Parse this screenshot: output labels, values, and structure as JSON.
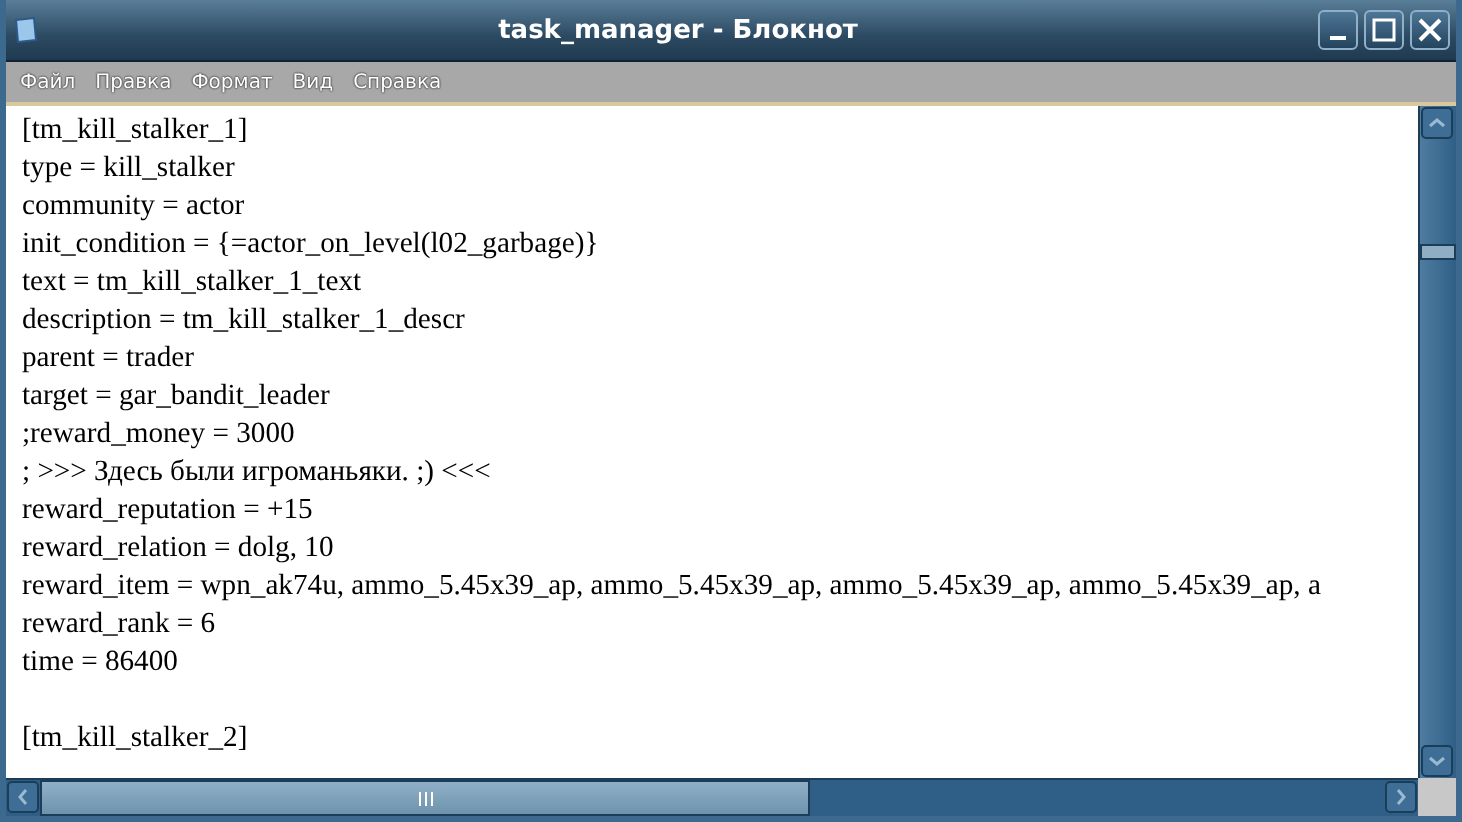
{
  "window": {
    "title": "task_manager - Блокнот"
  },
  "menu": [
    "Файл",
    "Правка",
    "Формат",
    "Вид",
    "Справка"
  ],
  "lines": [
    {
      "kind": "text",
      "text": "[tm_kill_stalker_1]"
    },
    {
      "kind": "text",
      "text": "type = kill_stalker"
    },
    {
      "kind": "text",
      "text": "community = actor"
    },
    {
      "kind": "text",
      "text": "init_condition = {=actor_on_level(l02_garbage)}"
    },
    {
      "kind": "text",
      "text": "text = tm_kill_stalker_1_text"
    },
    {
      "kind": "text",
      "text": "description = tm_kill_stalker_1_descr"
    },
    {
      "kind": "text",
      "text": "parent = trader"
    },
    {
      "kind": "text",
      "text": "target = gar_bandit_leader"
    },
    {
      "kind": "text",
      "text": ";reward_money = 3000"
    },
    {
      "kind": "text",
      "text": "; >>> Здесь были игроманьяки. ;) <<<"
    },
    {
      "kind": "text",
      "text": "reward_reputation = +15"
    },
    {
      "kind": "text",
      "text": "reward_relation = dolg, 10"
    },
    {
      "kind": "text",
      "text": "reward_item = wpn_ak74u, ammo_5.45x39_ap, ammo_5.45x39_ap, ammo_5.45x39_ap, ammo_5.45x39_ap, a"
    },
    {
      "kind": "text",
      "text": "reward_rank = 6"
    },
    {
      "kind": "text",
      "text": "time = 86400"
    },
    {
      "kind": "blank"
    },
    {
      "kind": "text",
      "text": "[tm_kill_stalker_2]"
    }
  ]
}
